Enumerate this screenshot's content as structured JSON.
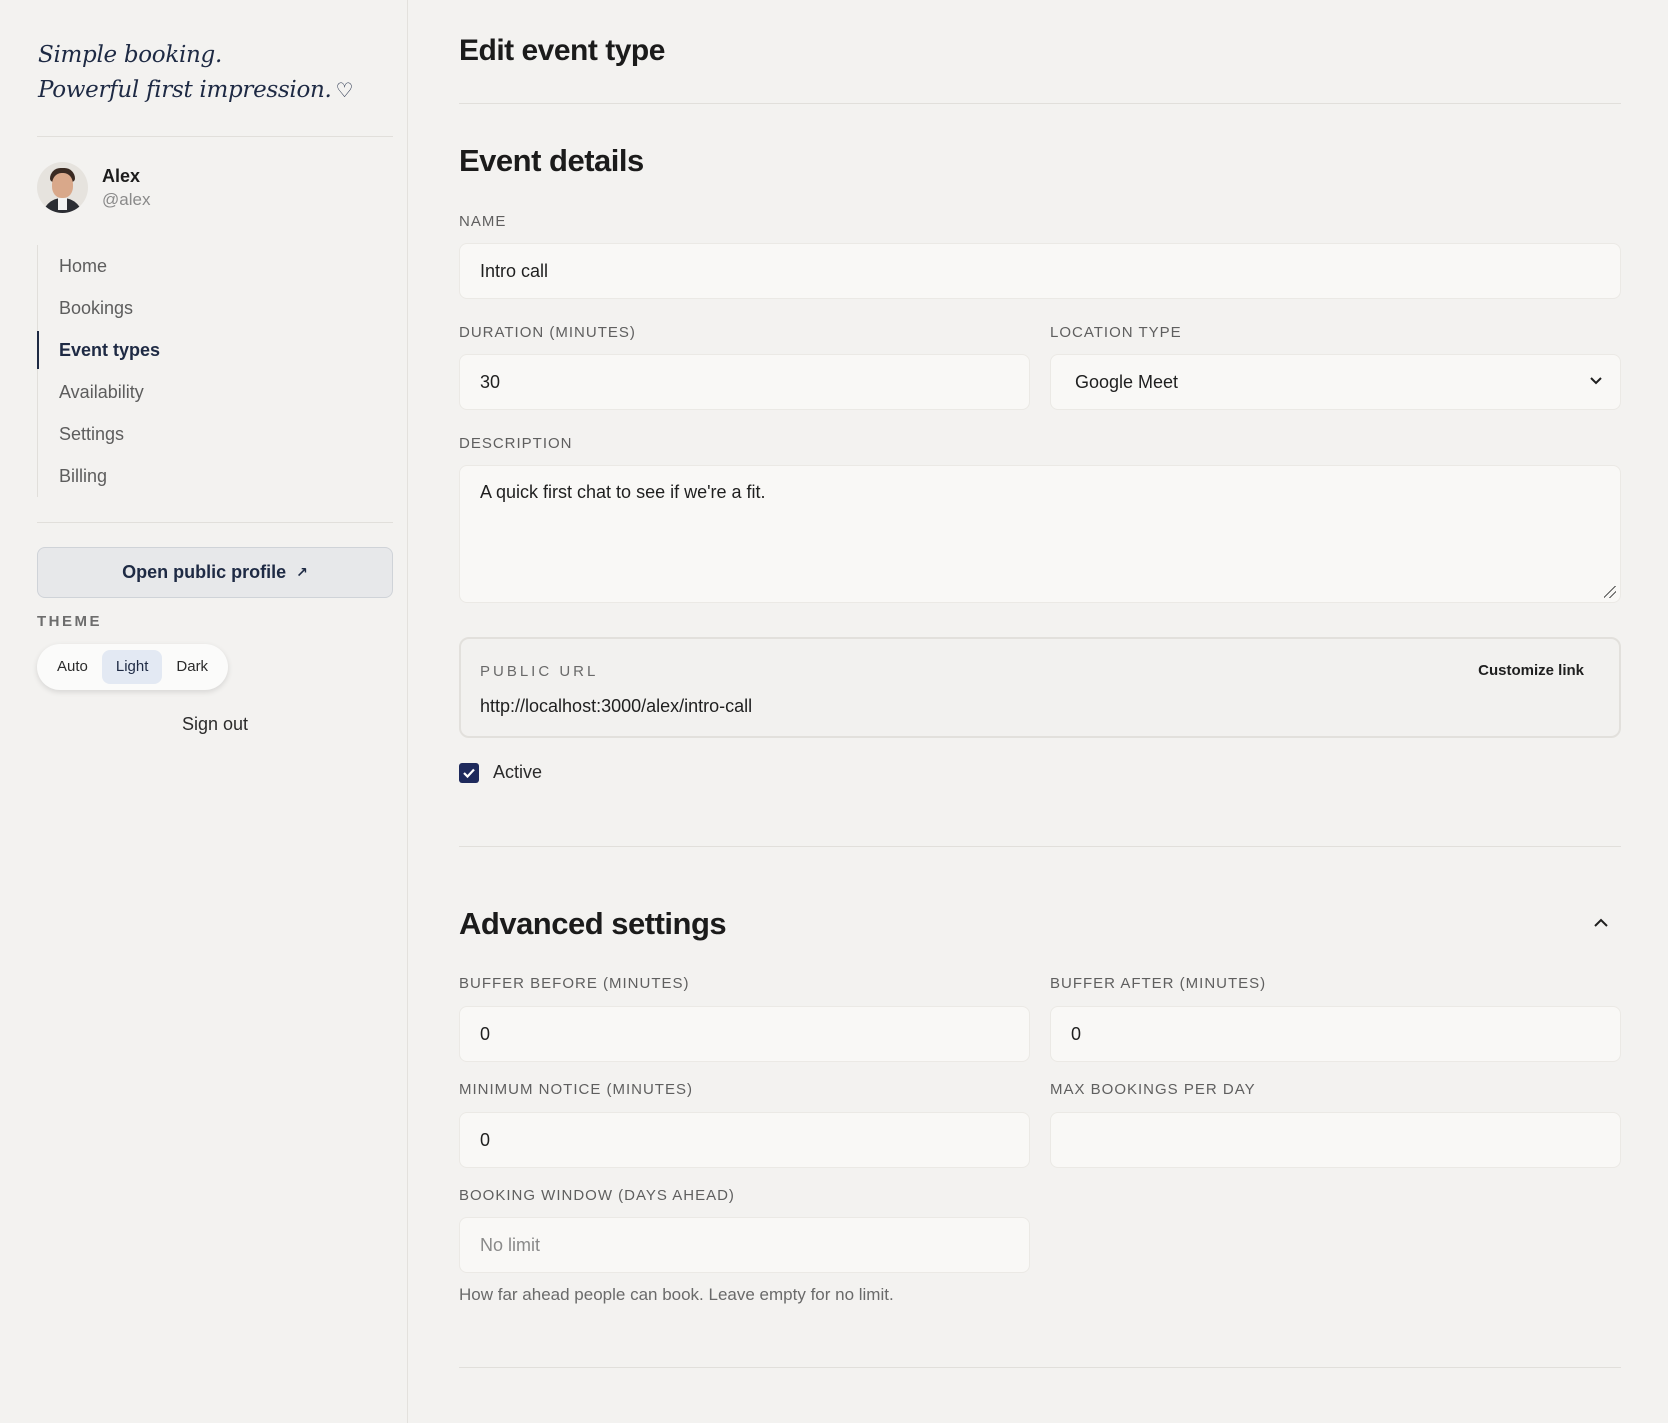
{
  "sidebar": {
    "tagline_line1": "Simple booking.",
    "tagline_line2": "Powerful first impression.",
    "heart_icon": "♡",
    "user": {
      "name": "Alex",
      "handle": "@alex"
    },
    "nav": [
      {
        "label": "Home",
        "active": false
      },
      {
        "label": "Bookings",
        "active": false
      },
      {
        "label": "Event types",
        "active": true
      },
      {
        "label": "Availability",
        "active": false
      },
      {
        "label": "Settings",
        "active": false
      },
      {
        "label": "Billing",
        "active": false
      }
    ],
    "public_profile_label": "Open public profile",
    "public_profile_icon": "↗",
    "theme_label": "THEME",
    "theme_options": [
      "Auto",
      "Light",
      "Dark"
    ],
    "theme_selected": "Light",
    "sign_out_label": "Sign out"
  },
  "main": {
    "page_title": "Edit event type",
    "event_details": {
      "title": "Event details",
      "name_label": "NAME",
      "name_value": "Intro call",
      "duration_label": "DURATION (MINUTES)",
      "duration_value": "30",
      "location_label": "LOCATION TYPE",
      "location_value": "Google Meet",
      "description_label": "DESCRIPTION",
      "description_value": "A quick first chat to see if we're a fit.",
      "public_url_label": "PUBLIC URL",
      "public_url_value": "http://localhost:3000/alex/intro-call",
      "customize_link_label": "Customize link",
      "active_label": "Active",
      "active_checked": true
    },
    "advanced": {
      "title": "Advanced settings",
      "expanded": true,
      "buffer_before_label": "BUFFER BEFORE (MINUTES)",
      "buffer_before_value": "0",
      "buffer_after_label": "BUFFER AFTER (MINUTES)",
      "buffer_after_value": "0",
      "min_notice_label": "MINIMUM NOTICE (MINUTES)",
      "min_notice_value": "0",
      "max_bookings_label": "MAX BOOKINGS PER DAY",
      "max_bookings_value": "",
      "booking_window_label": "BOOKING WINDOW (DAYS AHEAD)",
      "booking_window_placeholder": "No limit",
      "booking_window_help": "How far ahead people can book. Leave empty for no limit."
    }
  },
  "colors": {
    "accent": "#1e2a44",
    "background": "#f3f2f0",
    "checkbox": "#1e2a5c"
  }
}
